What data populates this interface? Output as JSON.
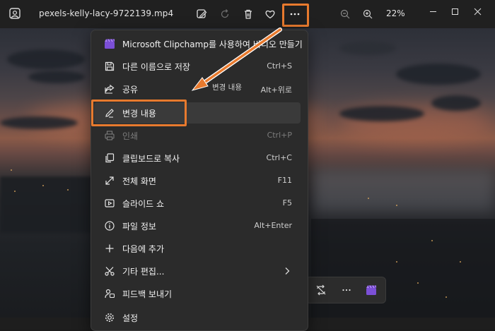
{
  "titlebar": {
    "filename": "pexels-kelly-lacy-9722139.mp4",
    "zoom": "22%"
  },
  "menu": {
    "items": [
      {
        "label": "Microsoft Clipchamp를 사용하여 비디오 만들기",
        "shortcut": ""
      },
      {
        "label": "다른 이름으로 저장",
        "shortcut": "Ctrl+S"
      },
      {
        "label": "공유",
        "shortcut": "Alt+위로"
      },
      {
        "label": "변경 내용",
        "shortcut": ""
      },
      {
        "label": "인쇄",
        "shortcut": "Ctrl+P"
      },
      {
        "label": "클립보드로 복사",
        "shortcut": "Ctrl+C"
      },
      {
        "label": "전체 화면",
        "shortcut": "F11"
      },
      {
        "label": "슬라이드 쇼",
        "shortcut": "F5"
      },
      {
        "label": "파일 정보",
        "shortcut": "Alt+Enter"
      },
      {
        "label": "다음에 추가",
        "shortcut": ""
      },
      {
        "label": "기타 편집...",
        "shortcut": ""
      },
      {
        "label": "피드백 보내기",
        "shortcut": ""
      },
      {
        "label": "설정",
        "shortcut": ""
      }
    ]
  },
  "annotation": {
    "tooltip": "변경 내용"
  },
  "colors": {
    "accent_box": "#e87a2e",
    "menu_bg": "#2b2b2b",
    "titlebar_bg": "#202020"
  }
}
